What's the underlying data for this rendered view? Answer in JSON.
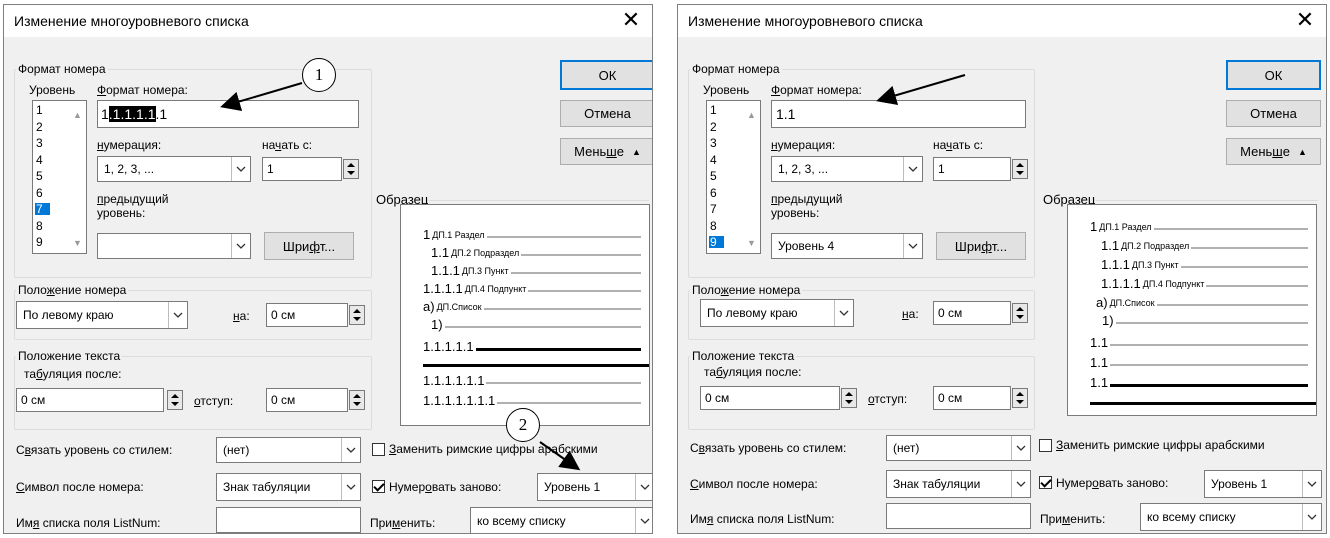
{
  "dialog_left": {
    "title": "Изменение многоуровневого списка",
    "number_format_group": "Формат номера",
    "level_label": "Уровень",
    "format_label": "Формат номера:",
    "format_value_parts": [
      "1",
      ".1.1.1.1",
      ".1"
    ],
    "levels": [
      "1",
      "2",
      "3",
      "4",
      "5",
      "6",
      "7",
      "8",
      "9"
    ],
    "selected_level": "7",
    "numbering_label": "нумерация:",
    "numbering_value": "1, 2, 3, ...",
    "start_label": "начать с:",
    "start_value": "1",
    "prev_level_label_1": "предыдущий",
    "prev_level_label_2": "уровень:",
    "prev_level_value": "",
    "font_button": "Шрифт...",
    "ok_button": "ОК",
    "cancel_button": "Отмена",
    "less_button": "Меньше",
    "preview_label": "Образец",
    "preview_rows": [
      {
        "num": "1",
        "style": "ДП.1 Раздел"
      },
      {
        "num": "1.1",
        "style": "ДП.2 Подраздел"
      },
      {
        "num": "1.1.1",
        "style": "ДП.3 Пункт"
      },
      {
        "num": "1.1.1.1",
        "style": "ДП.4 Подпункт"
      },
      {
        "num": "а)",
        "style": "ДП.Список"
      },
      {
        "num": "1)",
        "style": ""
      },
      {
        "num": "1.1.1.1.1",
        "style": ""
      },
      {
        "num": "1.1.1.1.1.1",
        "style": ""
      },
      {
        "num": "1.1.1.1.1.1.1",
        "style": ""
      }
    ],
    "number_position_group": "Положение номера",
    "alignment_value": "По левому краю",
    "at_label": "на:",
    "at_value": "0 см",
    "text_position_group": "Положение текста",
    "tab_after_label": "табуляция после:",
    "tab_after_value": "0 см",
    "indent_label": "отступ:",
    "indent_value": "0 см",
    "link_style_label": "Связать уровень со стилем:",
    "link_style_value": "(нет)",
    "roman_label": "Заменить римские цифры арабскими",
    "roman_checked": false,
    "symbol_after_label": "Символ после номера:",
    "symbol_after_value": "Знак табуляции",
    "restart_label": "Нумеровать заново:",
    "restart_checked": true,
    "restart_value": "Уровень 1",
    "listnum_label": "Имя списка поля ListNum:",
    "listnum_value": "",
    "apply_label": "Применить:",
    "apply_value": "ко всему списку",
    "callout_1": "1",
    "callout_2": "2"
  },
  "dialog_right": {
    "title": "Изменение многоуровневого списка",
    "number_format_group": "Формат номера",
    "level_label": "Уровень",
    "format_label": "Формат номера:",
    "format_value": "1.1",
    "levels": [
      "1",
      "2",
      "3",
      "4",
      "5",
      "6",
      "7",
      "8",
      "9"
    ],
    "selected_level": "9",
    "numbering_label": "нумерация:",
    "numbering_value": "1, 2, 3, ...",
    "start_label": "начать с:",
    "start_value": "1",
    "prev_level_label_1": "предыдущий",
    "prev_level_label_2": "уровень:",
    "prev_level_value": "Уровень 4",
    "font_button": "Шрифт...",
    "ok_button": "ОК",
    "cancel_button": "Отмена",
    "less_button": "Меньше",
    "preview_label": "Образец",
    "preview_rows": [
      {
        "num": "1",
        "style": "ДП.1 Раздел"
      },
      {
        "num": "1.1",
        "style": "ДП.2 Подраздел"
      },
      {
        "num": "1.1.1",
        "style": "ДП.3 Пункт"
      },
      {
        "num": "1.1.1.1",
        "style": "ДП.4 Подпункт"
      },
      {
        "num": "а)",
        "style": "ДП.Список"
      },
      {
        "num": "1)",
        "style": ""
      },
      {
        "num": "1.1",
        "style": ""
      },
      {
        "num": "1.1",
        "style": ""
      },
      {
        "num": "1.1",
        "style": ""
      }
    ],
    "number_position_group": "Положение номера",
    "alignment_value": "По левому краю",
    "at_label": "на:",
    "at_value": "0 см",
    "text_position_group": "Положение текста",
    "tab_after_label": "табуляция после:",
    "tab_after_value": "0 см",
    "indent_label": "отступ:",
    "indent_value": "0 см",
    "link_style_label": "Связать уровень со стилем:",
    "link_style_value": "(нет)",
    "roman_label": "Заменить римские цифры арабскими",
    "roman_checked": false,
    "symbol_after_label": "Символ после номера:",
    "symbol_after_value": "Знак табуляции",
    "restart_label": "Нумеровать заново:",
    "restart_checked": true,
    "restart_value": "Уровень 1",
    "listnum_label": "Имя списка поля ListNum:",
    "listnum_value": "",
    "apply_label": "Применить:",
    "apply_value": "ко всему списку"
  },
  "icons": {
    "close": "close-icon",
    "dropdown": "chevron-down-icon",
    "less": "chevron-up-icon"
  },
  "colors": {
    "selection": "#0078d7",
    "dialog_bg": "#f0f0f0",
    "default_button_border": "#0078d7"
  }
}
